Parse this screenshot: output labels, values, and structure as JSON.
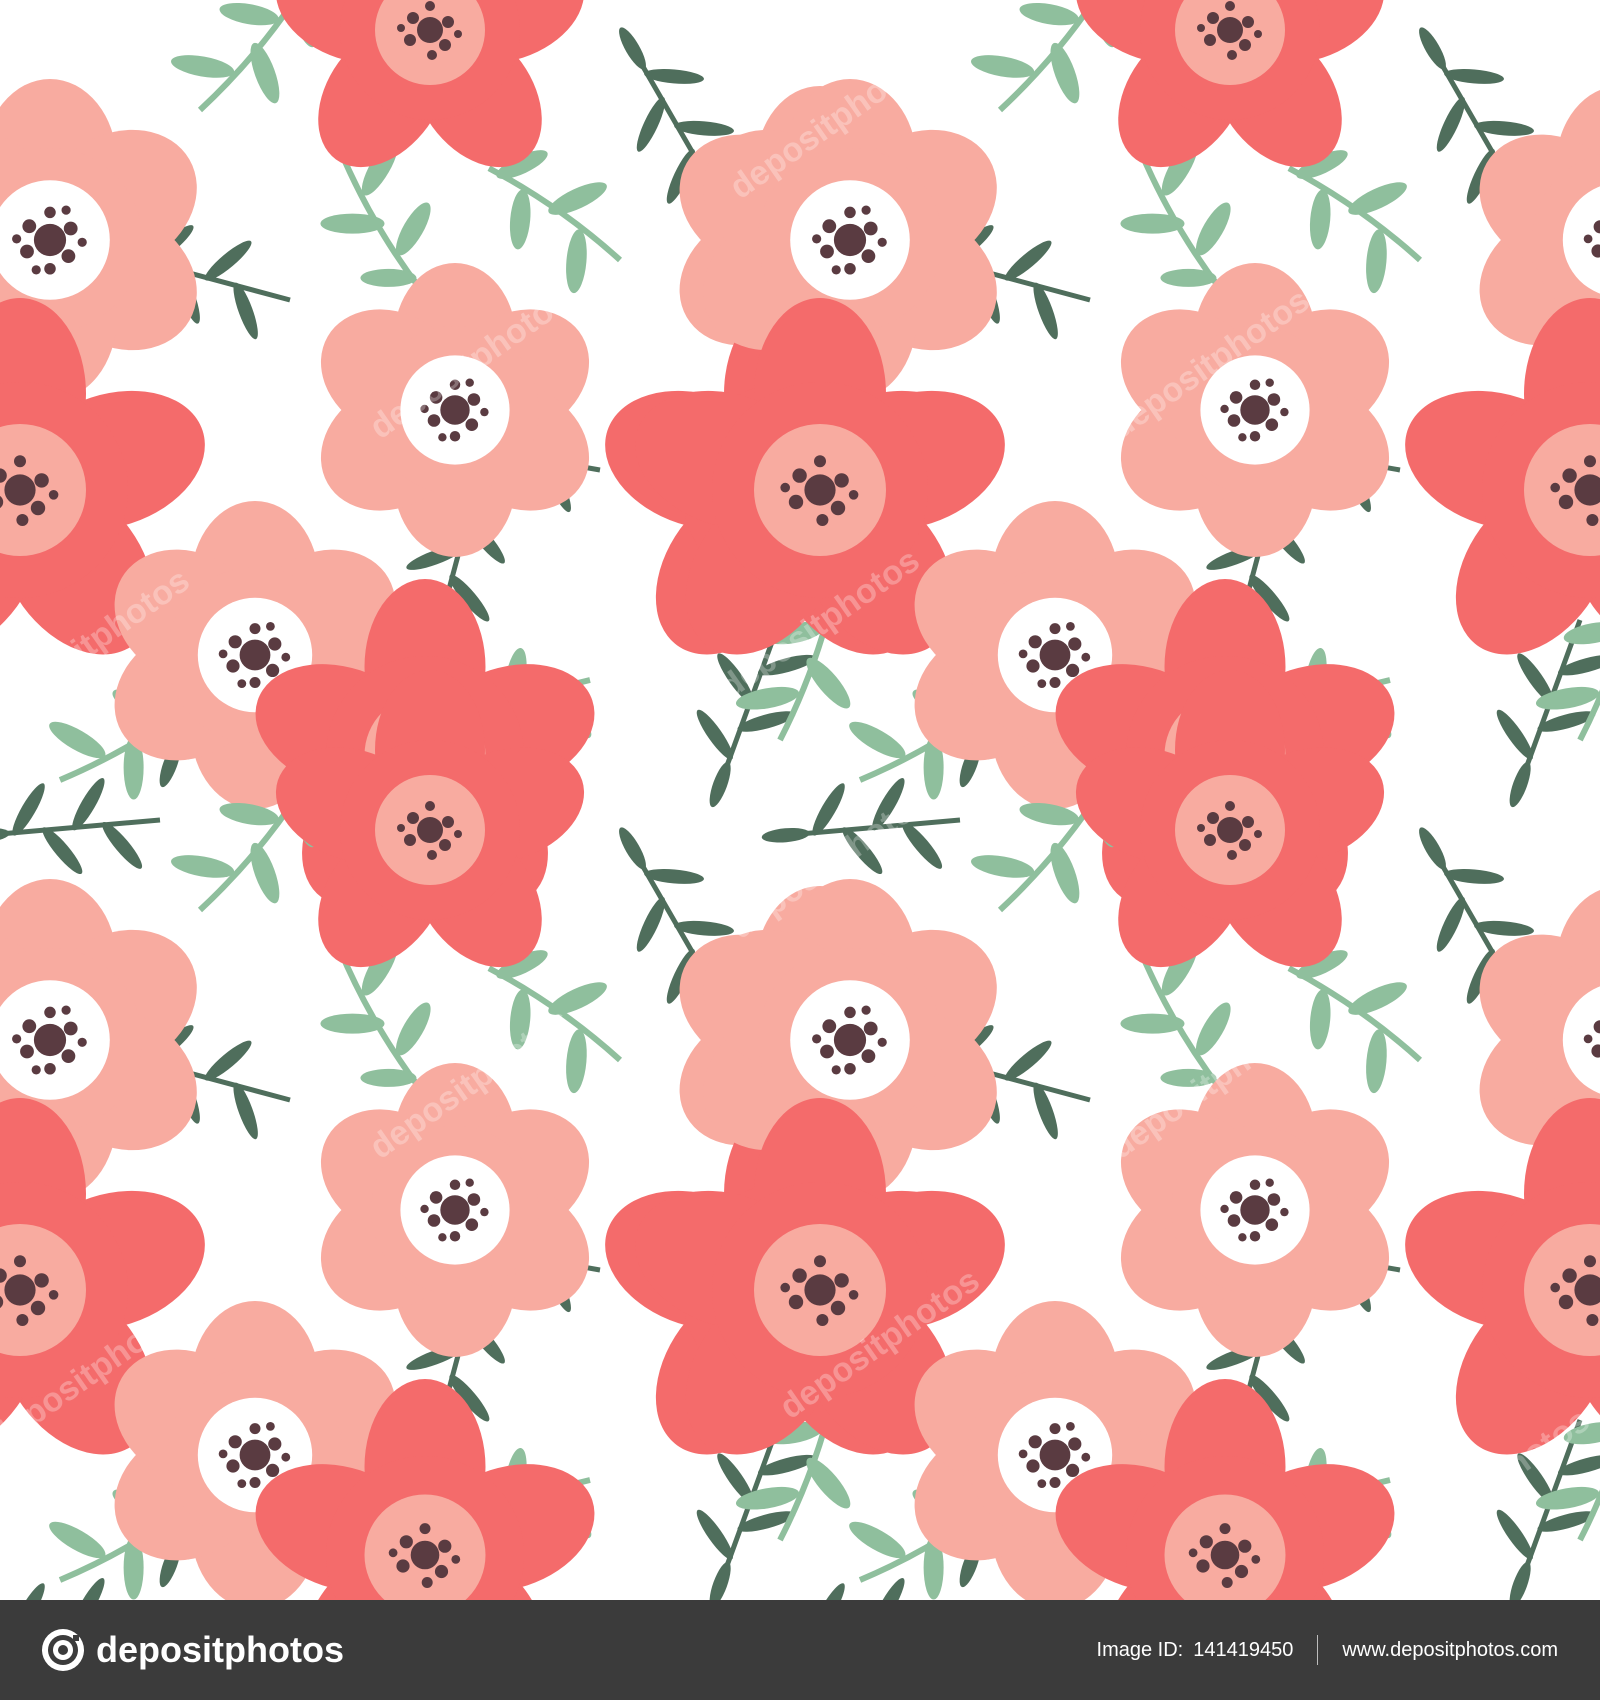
{
  "colors": {
    "coral": "#f46b6b",
    "pink": "#f8aba0",
    "sage": "#8fbf9d",
    "darkgreen": "#4f6e5c",
    "center": "#5a3b41",
    "white": "#ffffff",
    "footer_bg": "#3b3b3b"
  },
  "watermark": "depositphotos",
  "footer": {
    "brand": "depositphotos",
    "image_id_label": "Image ID:",
    "image_id": "141419450",
    "url": "www.depositphotos.com"
  }
}
